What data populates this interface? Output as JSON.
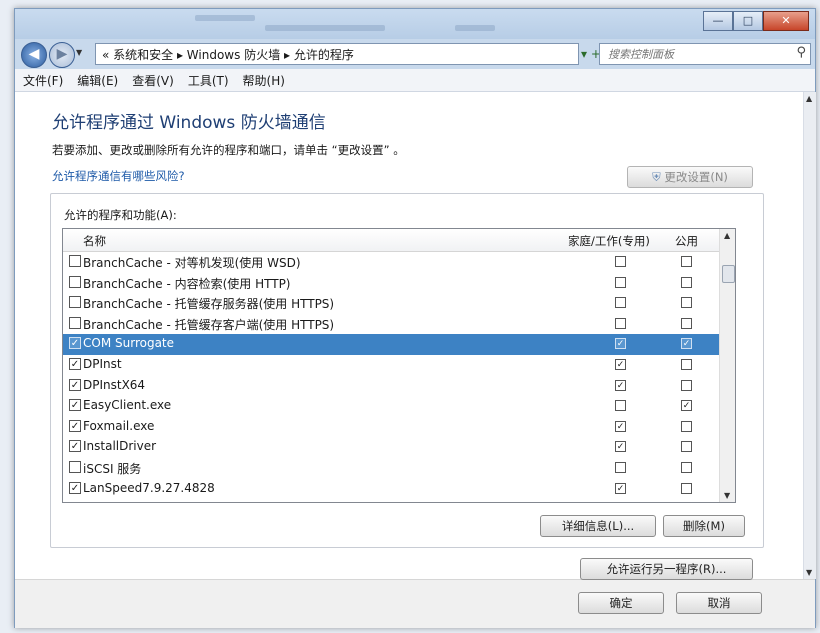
{
  "window": {
    "buttons": {
      "minimize": "—",
      "maximize": "□",
      "close": "✕"
    }
  },
  "nav": {
    "back_glyph": "◀",
    "forward_glyph": "▶",
    "address": "« 系统和安全 ▸ Windows 防火墙 ▸ 允许的程序",
    "refresh_glyph": "▾ +→",
    "search_placeholder": "搜索控制面板",
    "search_icon": "⚲"
  },
  "menu": [
    "文件(F)",
    "编辑(E)",
    "查看(V)",
    "工具(T)",
    "帮助(H)"
  ],
  "page": {
    "title": "允许程序通过 Windows 防火墙通信",
    "description": "若要添加、更改或删除所有允许的程序和端口，请单击 “更改设置” 。",
    "risk_link": "允许程序通信有哪些风险?",
    "change_settings_label": "更改设置(N)",
    "change_settings_icon": "shield-icon",
    "list_label": "允许的程序和功能(A):"
  },
  "list": {
    "columns": [
      "名称",
      "家庭/工作(专用)",
      "公用"
    ],
    "rows": [
      {
        "name": "BranchCache - 对等机发现(使用 WSD)",
        "enabled": false,
        "private": false,
        "public": false
      },
      {
        "name": "BranchCache - 内容检索(使用 HTTP)",
        "enabled": false,
        "private": false,
        "public": false
      },
      {
        "name": "BranchCache - 托管缓存服务器(使用 HTTPS)",
        "enabled": false,
        "private": false,
        "public": false
      },
      {
        "name": "BranchCache - 托管缓存客户端(使用 HTTPS)",
        "enabled": false,
        "private": false,
        "public": false
      },
      {
        "name": "COM Surrogate",
        "enabled": true,
        "private": true,
        "public": true,
        "selected": true
      },
      {
        "name": "DPInst",
        "enabled": true,
        "private": true,
        "public": false
      },
      {
        "name": "DPInstX64",
        "enabled": true,
        "private": true,
        "public": false
      },
      {
        "name": "EasyClient.exe",
        "enabled": true,
        "private": false,
        "public": true
      },
      {
        "name": "Foxmail.exe",
        "enabled": true,
        "private": true,
        "public": false
      },
      {
        "name": "InstallDriver",
        "enabled": true,
        "private": true,
        "public": false
      },
      {
        "name": "iSCSI 服务",
        "enabled": false,
        "private": false,
        "public": false
      },
      {
        "name": "LanSpeed7.9.27.4828",
        "enabled": true,
        "private": true,
        "public": false
      }
    ]
  },
  "buttons": {
    "details": "详细信息(L)...",
    "remove": "删除(M)",
    "allow_another": "允许运行另一程序(R)...",
    "ok": "确定",
    "cancel": "取消"
  },
  "colors": {
    "selection": "#3d82c4",
    "title_text": "#1f3f74",
    "link": "#1e5aa8"
  }
}
